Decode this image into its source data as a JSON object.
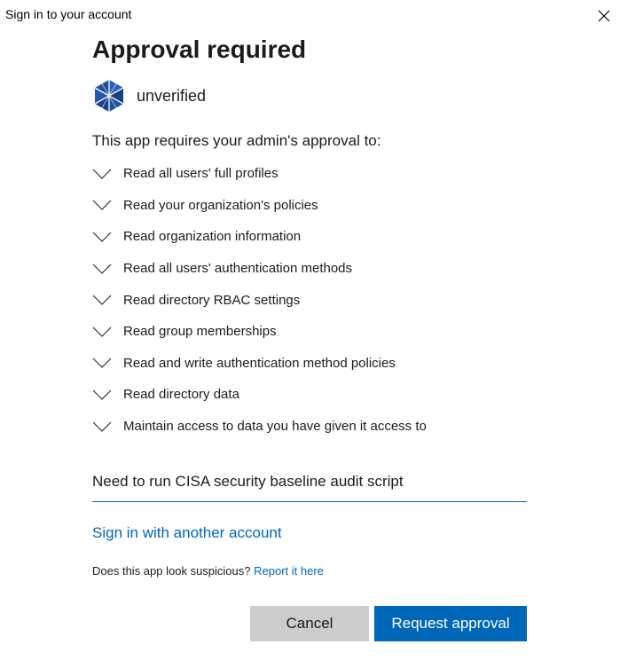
{
  "window": {
    "title": "Sign in to your account"
  },
  "dialog": {
    "heading": "Approval required",
    "app_name": "unverified",
    "app_icon": "app-logo-icon",
    "intro": "This app requires your admin's approval to:",
    "permissions": [
      "Read all users' full profiles",
      "Read your organization's policies",
      "Read organization information",
      "Read all users' authentication methods",
      "Read directory RBAC settings",
      "Read group memberships",
      "Read and write authentication method policies",
      "Read directory data",
      "Maintain access to data you have given it access to"
    ],
    "justification_value": "Need to run CISA security baseline audit script",
    "other_account_link": "Sign in with another account",
    "suspicious_text": "Does this app look suspicious?",
    "report_link": "Report it here",
    "cancel_label": "Cancel",
    "request_label": "Request approval"
  },
  "colors": {
    "accent": "#0067b8",
    "cancel_bg": "#cccccc",
    "text": "#1b1b1b"
  }
}
